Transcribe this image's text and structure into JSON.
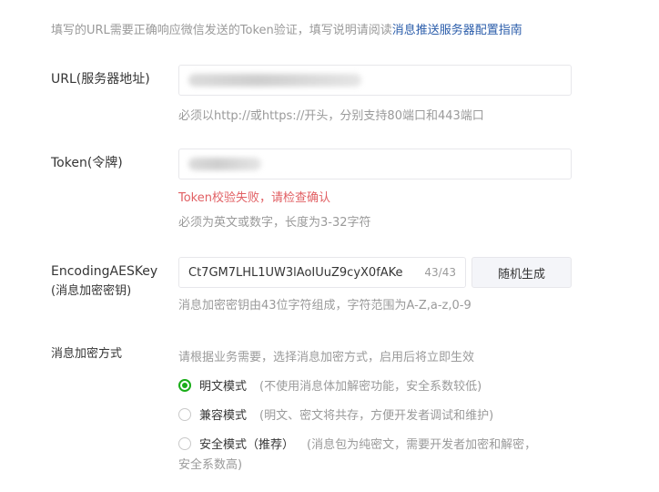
{
  "intro": {
    "text": "填写的URL需要正确响应微信发送的Token验证，填写说明请阅读",
    "link": "消息推送服务器配置指南"
  },
  "url": {
    "label": "URL(服务器地址)",
    "hint": "必须以http://或https://开头，分别支持80端口和443端口"
  },
  "token": {
    "label": "Token(令牌)",
    "error": "Token校验失败，请检查确认",
    "hint": "必须为英文或数字，长度为3-32字符"
  },
  "aes": {
    "label_line1": "EncodingAESKey",
    "label_line2": "(消息加密密钥)",
    "value": "Ct7GM7LHL1UW3lAoIUuZ9cyX0fAKe",
    "counter": "43/43",
    "button": "随机生成",
    "hint": "消息加密密钥由43位字符组成，字符范围为A-Z,a-z,0-9"
  },
  "encrypt": {
    "label": "消息加密方式",
    "hint": "请根据业务需要，选择消息加密方式，启用后将立即生效",
    "options": [
      {
        "label": "明文模式",
        "desc": "(不使用消息体加解密功能，安全系数较低)",
        "checked": true
      },
      {
        "label": "兼容模式",
        "desc": "(明文、密文将共存，方便开发者调试和维护)",
        "checked": false
      },
      {
        "label": "安全模式（推荐）",
        "desc": "(消息包为纯密文，需要开发者加密和解密，",
        "desc2": "安全系数高)",
        "checked": false
      }
    ]
  },
  "colors": {
    "accent_green": "#1aad19",
    "error_red": "#e15f63",
    "link_blue": "#2a5caa"
  }
}
